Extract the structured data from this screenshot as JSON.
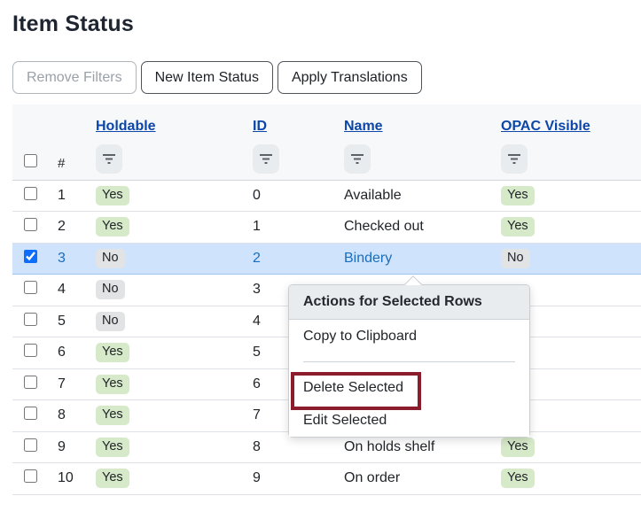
{
  "page": {
    "title": "Item Status"
  },
  "toolbar": {
    "buttons": [
      {
        "label": "Remove Filters",
        "disabled": true
      },
      {
        "label": "New Item Status",
        "disabled": false
      },
      {
        "label": "Apply Translations",
        "disabled": false
      }
    ]
  },
  "grid": {
    "row_number_header": "#",
    "columns": [
      {
        "label": "Holdable",
        "sortable": true,
        "filterable": true
      },
      {
        "label": "ID",
        "sortable": true,
        "filterable": true
      },
      {
        "label": "Name",
        "sortable": true,
        "filterable": true
      },
      {
        "label": "OPAC Visible",
        "sortable": true,
        "filterable": true
      }
    ],
    "rows": [
      {
        "num": "1",
        "holdable": "Yes",
        "id": "0",
        "name": "Available",
        "opac": "Yes",
        "selected": false
      },
      {
        "num": "2",
        "holdable": "Yes",
        "id": "1",
        "name": "Checked out",
        "opac": "Yes",
        "selected": false
      },
      {
        "num": "3",
        "holdable": "No",
        "id": "2",
        "name": "Bindery",
        "opac": "No",
        "selected": true
      },
      {
        "num": "4",
        "holdable": "No",
        "id": "3",
        "name": "",
        "opac": "",
        "selected": false
      },
      {
        "num": "5",
        "holdable": "No",
        "id": "4",
        "name": "",
        "opac": "",
        "selected": false
      },
      {
        "num": "6",
        "holdable": "Yes",
        "id": "5",
        "name": "",
        "opac": "",
        "selected": false
      },
      {
        "num": "7",
        "holdable": "Yes",
        "id": "6",
        "name": "",
        "opac": "",
        "selected": false
      },
      {
        "num": "8",
        "holdable": "Yes",
        "id": "7",
        "name": "",
        "opac": "",
        "selected": false
      },
      {
        "num": "9",
        "holdable": "Yes",
        "id": "8",
        "name": "On holds shelf",
        "opac": "Yes",
        "selected": false
      },
      {
        "num": "10",
        "holdable": "Yes",
        "id": "9",
        "name": "On order",
        "opac": "Yes",
        "selected": false
      }
    ]
  },
  "context_menu": {
    "title": "Actions for Selected Rows",
    "items": [
      "Copy to Clipboard",
      "Delete Selected",
      "Edit Selected"
    ],
    "highlighted_item": "Delete Selected"
  },
  "colors": {
    "header_link": "#0b46a8",
    "selected_row_bg": "#cfe4fc",
    "selected_row_text": "#1a6cbc",
    "badge_yes_bg": "#d6e9c9",
    "badge_no_bg": "#e2e3e5",
    "menu_header_bg": "#e9ecef",
    "highlight_border": "#8a1c2c",
    "checkbox_accent": "#0d6efd"
  }
}
